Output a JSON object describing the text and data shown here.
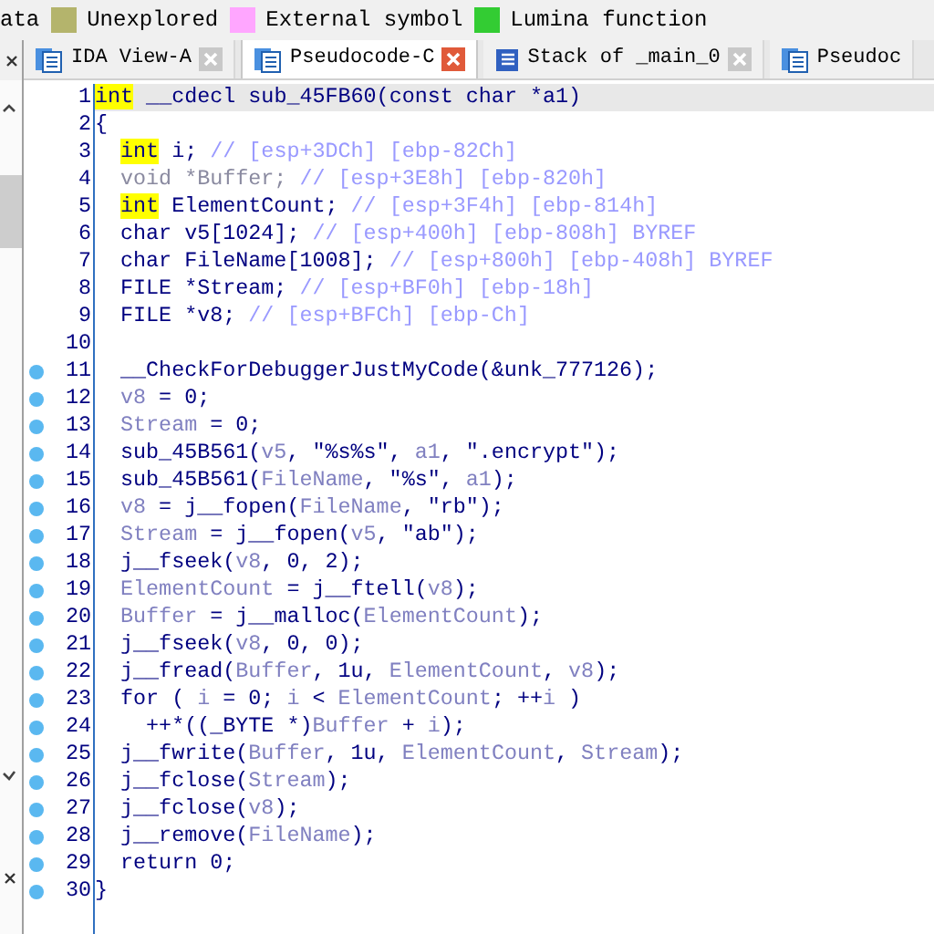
{
  "legend": [
    {
      "label": "ata"
    },
    {
      "label": "Unexplored",
      "color": "#b4b46c"
    },
    {
      "label": "External symbol",
      "color": "#ffa6ff"
    },
    {
      "label": "Lumina function",
      "color": "#33cc33"
    }
  ],
  "tabs": [
    {
      "label": "IDA View-A",
      "selected": false,
      "kind": "doc"
    },
    {
      "label": "Pseudocode-C",
      "selected": true,
      "kind": "doc"
    },
    {
      "label": "Stack of _main_0",
      "selected": false,
      "kind": "stack"
    },
    {
      "label": "Pseudoc",
      "selected": false,
      "kind": "doc"
    }
  ],
  "lines": [
    {
      "num": "1",
      "breakpoint": false,
      "current": true,
      "kind": "head",
      "tokens": [
        {
          "kind": "keyword",
          "text": "int"
        },
        {
          "kind": "code",
          "text": " __cdecl sub_45FB60(const char *a1)"
        }
      ]
    },
    {
      "num": "2",
      "breakpoint": false,
      "current": false,
      "kind": "head",
      "tokens": [
        {
          "kind": "code",
          "text": "{"
        }
      ]
    },
    {
      "num": "3",
      "breakpoint": false,
      "current": false,
      "kind": "body",
      "tokens": [
        {
          "kind": "keyword",
          "text": "int"
        },
        {
          "kind": "code",
          "text": " i; "
        },
        {
          "kind": "comment",
          "text": "// [esp+3DCh] [ebp-82Ch]"
        }
      ]
    },
    {
      "num": "4",
      "breakpoint": false,
      "current": false,
      "kind": "body",
      "tokens": [
        {
          "kind": "unused",
          "text": "void *Buffer; "
        },
        {
          "kind": "comment",
          "text": "// [esp+3E8h] [ebp-820h]"
        }
      ]
    },
    {
      "num": "5",
      "breakpoint": false,
      "current": false,
      "kind": "body",
      "tokens": [
        {
          "kind": "keyword",
          "text": "int"
        },
        {
          "kind": "code",
          "text": " ElementCount; "
        },
        {
          "kind": "comment",
          "text": "// [esp+3F4h] [ebp-814h]"
        }
      ]
    },
    {
      "num": "6",
      "breakpoint": false,
      "current": false,
      "kind": "body",
      "tokens": [
        {
          "kind": "code",
          "text": "char v5[1024]; "
        },
        {
          "kind": "comment",
          "text": "// [esp+400h] [ebp-808h] BYREF"
        }
      ]
    },
    {
      "num": "7",
      "breakpoint": false,
      "current": false,
      "kind": "body",
      "tokens": [
        {
          "kind": "code",
          "text": "char FileName[1008]; "
        },
        {
          "kind": "comment",
          "text": "// [esp+800h] [ebp-408h] BYREF"
        }
      ]
    },
    {
      "num": "8",
      "breakpoint": false,
      "current": false,
      "kind": "body",
      "tokens": [
        {
          "kind": "code",
          "text": "FILE *Stream; "
        },
        {
          "kind": "comment",
          "text": "// [esp+BF0h] [ebp-18h]"
        }
      ]
    },
    {
      "num": "9",
      "breakpoint": false,
      "current": false,
      "kind": "body",
      "tokens": [
        {
          "kind": "code",
          "text": "FILE *v8; "
        },
        {
          "kind": "comment",
          "text": "// [esp+BFCh] [ebp-Ch]"
        }
      ]
    },
    {
      "num": "10",
      "breakpoint": false,
      "current": false
    },
    {
      "num": "11",
      "breakpoint": true,
      "current": false,
      "kind": "body",
      "tokens": [
        {
          "kind": "code",
          "text": "__CheckForDebuggerJustMyCode(&unk_777126);"
        }
      ]
    },
    {
      "num": "12",
      "breakpoint": true,
      "current": false,
      "kind": "body",
      "tokens": [
        {
          "kind": "var",
          "text": "v8"
        },
        {
          "kind": "code",
          "text": " = 0;"
        }
      ]
    },
    {
      "num": "13",
      "breakpoint": true,
      "current": false,
      "kind": "body",
      "tokens": [
        {
          "kind": "var",
          "text": "Stream"
        },
        {
          "kind": "code",
          "text": " = 0;"
        }
      ]
    },
    {
      "num": "14",
      "breakpoint": true,
      "current": false,
      "kind": "body",
      "tokens": [
        {
          "kind": "code",
          "text": "sub_45B561("
        },
        {
          "kind": "var",
          "text": "v5"
        },
        {
          "kind": "code",
          "text": ", \"%s%s\", "
        },
        {
          "kind": "var",
          "text": "a1"
        },
        {
          "kind": "code",
          "text": ", \".encrypt\");"
        }
      ]
    },
    {
      "num": "15",
      "breakpoint": true,
      "current": false,
      "kind": "body",
      "tokens": [
        {
          "kind": "code",
          "text": "sub_45B561("
        },
        {
          "kind": "var",
          "text": "FileName"
        },
        {
          "kind": "code",
          "text": ", \"%s\", "
        },
        {
          "kind": "var",
          "text": "a1"
        },
        {
          "kind": "code",
          "text": ");"
        }
      ]
    },
    {
      "num": "16",
      "breakpoint": true,
      "current": false,
      "kind": "body",
      "tokens": [
        {
          "kind": "var",
          "text": "v8"
        },
        {
          "kind": "code",
          "text": " = j__fopen("
        },
        {
          "kind": "var",
          "text": "FileName"
        },
        {
          "kind": "code",
          "text": ", \"rb\");"
        }
      ]
    },
    {
      "num": "17",
      "breakpoint": true,
      "current": false,
      "kind": "body",
      "tokens": [
        {
          "kind": "var",
          "text": "Stream"
        },
        {
          "kind": "code",
          "text": " = j__fopen("
        },
        {
          "kind": "var",
          "text": "v5"
        },
        {
          "kind": "code",
          "text": ", \"ab\");"
        }
      ]
    },
    {
      "num": "18",
      "breakpoint": true,
      "current": false,
      "kind": "body",
      "tokens": [
        {
          "kind": "code",
          "text": "j__fseek("
        },
        {
          "kind": "var",
          "text": "v8"
        },
        {
          "kind": "code",
          "text": ", 0, 2);"
        }
      ]
    },
    {
      "num": "19",
      "breakpoint": true,
      "current": false,
      "kind": "body",
      "tokens": [
        {
          "kind": "var",
          "text": "ElementCount"
        },
        {
          "kind": "code",
          "text": " = j__ftell("
        },
        {
          "kind": "var",
          "text": "v8"
        },
        {
          "kind": "code",
          "text": ");"
        }
      ]
    },
    {
      "num": "20",
      "breakpoint": true,
      "current": false,
      "kind": "body",
      "tokens": [
        {
          "kind": "var",
          "text": "Buffer"
        },
        {
          "kind": "code",
          "text": " = j__malloc("
        },
        {
          "kind": "var",
          "text": "ElementCount"
        },
        {
          "kind": "code",
          "text": ");"
        }
      ]
    },
    {
      "num": "21",
      "breakpoint": true,
      "current": false,
      "kind": "body",
      "tokens": [
        {
          "kind": "code",
          "text": "j__fseek("
        },
        {
          "kind": "var",
          "text": "v8"
        },
        {
          "kind": "code",
          "text": ", 0, 0);"
        }
      ]
    },
    {
      "num": "22",
      "breakpoint": true,
      "current": false,
      "kind": "body",
      "tokens": [
        {
          "kind": "code",
          "text": "j__fread("
        },
        {
          "kind": "var",
          "text": "Buffer"
        },
        {
          "kind": "code",
          "text": ", 1u, "
        },
        {
          "kind": "var",
          "text": "ElementCount"
        },
        {
          "kind": "code",
          "text": ", "
        },
        {
          "kind": "var",
          "text": "v8"
        },
        {
          "kind": "code",
          "text": ");"
        }
      ]
    },
    {
      "num": "23",
      "breakpoint": true,
      "current": false,
      "kind": "body",
      "tokens": [
        {
          "kind": "code",
          "text": "for ( "
        },
        {
          "kind": "var",
          "text": "i"
        },
        {
          "kind": "code",
          "text": " = 0; "
        },
        {
          "kind": "var",
          "text": "i"
        },
        {
          "kind": "code",
          "text": " < "
        },
        {
          "kind": "var",
          "text": "ElementCount"
        },
        {
          "kind": "code",
          "text": "; ++"
        },
        {
          "kind": "var",
          "text": "i"
        },
        {
          "kind": "code",
          "text": " )"
        }
      ]
    },
    {
      "num": "24",
      "breakpoint": true,
      "current": false,
      "kind": "inner",
      "tokens": [
        {
          "kind": "code",
          "text": "++*((_BYTE *)"
        },
        {
          "kind": "var",
          "text": "Buffer"
        },
        {
          "kind": "code",
          "text": " + "
        },
        {
          "kind": "var",
          "text": "i"
        },
        {
          "kind": "code",
          "text": ");"
        }
      ]
    },
    {
      "num": "25",
      "breakpoint": true,
      "current": false,
      "kind": "body",
      "tokens": [
        {
          "kind": "code",
          "text": "j__fwrite("
        },
        {
          "kind": "var",
          "text": "Buffer"
        },
        {
          "kind": "code",
          "text": ", 1u, "
        },
        {
          "kind": "var",
          "text": "ElementCount"
        },
        {
          "kind": "code",
          "text": ", "
        },
        {
          "kind": "var",
          "text": "Stream"
        },
        {
          "kind": "code",
          "text": ");"
        }
      ]
    },
    {
      "num": "26",
      "breakpoint": true,
      "current": false,
      "kind": "body",
      "tokens": [
        {
          "kind": "code",
          "text": "j__fclose("
        },
        {
          "kind": "var",
          "text": "Stream"
        },
        {
          "kind": "code",
          "text": ");"
        }
      ]
    },
    {
      "num": "27",
      "breakpoint": true,
      "current": false,
      "kind": "body",
      "tokens": [
        {
          "kind": "code",
          "text": "j__fclose("
        },
        {
          "kind": "var",
          "text": "v8"
        },
        {
          "kind": "code",
          "text": ");"
        }
      ]
    },
    {
      "num": "28",
      "breakpoint": true,
      "current": false,
      "kind": "body",
      "tokens": [
        {
          "kind": "code",
          "text": "j__remove("
        },
        {
          "kind": "var",
          "text": "FileName"
        },
        {
          "kind": "code",
          "text": ");"
        }
      ]
    },
    {
      "num": "29",
      "breakpoint": true,
      "current": false,
      "kind": "body",
      "tokens": [
        {
          "kind": "code",
          "text": "return 0;"
        }
      ]
    },
    {
      "num": "30",
      "breakpoint": true,
      "current": false,
      "kind": "head",
      "tokens": [
        {
          "kind": "code",
          "text": "}"
        }
      ]
    }
  ]
}
